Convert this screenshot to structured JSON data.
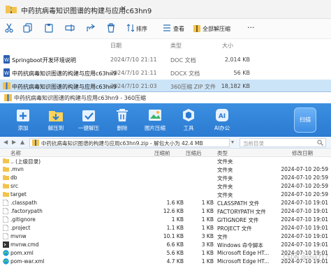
{
  "explorer": {
    "title": "中药抗病毒知识图谱的构建与应用c63hn9",
    "close_glyph": "×",
    "toolbar": {
      "sort_label": "排序",
      "view_label": "查看",
      "more_label": "···",
      "extract_all_label": "全部解压缩"
    },
    "columns": {
      "date": "日期",
      "type": "类型",
      "size": "大小"
    },
    "files": [
      {
        "name": "Springboot开发环境说明",
        "date": "2024/7/10 21:11",
        "type": "DOC 文档",
        "size": "2,014 KB",
        "icon": "word-doc-icon"
      },
      {
        "name": "中药抗病毒知识图谱的构建与应用c63hn9",
        "date": "2024/7/10 21:11",
        "type": "DOCX 文档",
        "size": "56 KB",
        "icon": "word-doc-icon"
      },
      {
        "name": "中药抗病毒知识图谱的构建与应用c63hn9",
        "date": "2024/7/10 21:03",
        "type": "360压缩 ZIP 文件",
        "size": "18,182 KB",
        "icon": "zip-archive-icon"
      }
    ]
  },
  "archive": {
    "title": "中药抗病毒知识图谱的构建与应用c63hn9 - 360压缩",
    "tools": [
      {
        "label": "添加",
        "icon": "add-icon"
      },
      {
        "label": "解压到",
        "icon": "extract-to-icon"
      },
      {
        "label": "一键解压",
        "icon": "one-click-extract-icon"
      },
      {
        "label": "删除",
        "icon": "delete-icon"
      },
      {
        "label": "图片压缩",
        "icon": "image-compress-icon"
      },
      {
        "label": "工具",
        "icon": "tools-icon"
      },
      {
        "label": "AI办公",
        "icon": "ai-office-icon"
      }
    ],
    "scan_label": "扫描",
    "path": "中药抗病毒知识图谱的构建与应用c63hn9.zip - 解包大小为 42.4 MB",
    "search_placeholder": "当前目录",
    "columns": {
      "name": "名称",
      "compressed": "压缩前",
      "size": "压缩后",
      "type": "类型",
      "date": "修改日期"
    },
    "files": [
      {
        "name": ".. (上级目录)",
        "compressed": "",
        "size": "",
        "type": "文件夹",
        "date": "",
        "icon": "folder-icon"
      },
      {
        "name": ".mvn",
        "compressed": "",
        "size": "",
        "type": "文件夹",
        "date": "2024-07-10 20:59",
        "icon": "folder-icon"
      },
      {
        "name": "db",
        "compressed": "",
        "size": "",
        "type": "文件夹",
        "date": "2024-07-10 20:59",
        "icon": "folder-icon"
      },
      {
        "name": "src",
        "compressed": "",
        "size": "",
        "type": "文件夹",
        "date": "2024-07-10 20:59",
        "icon": "folder-icon"
      },
      {
        "name": "target",
        "compressed": "",
        "size": "",
        "type": "文件夹",
        "date": "2024-07-10 20:59",
        "icon": "folder-icon"
      },
      {
        "name": ".classpath",
        "compressed": "1.6 KB",
        "size": "1 KB",
        "type": "CLASSPATH 文件",
        "date": "2024-07-10 19:01",
        "icon": "file-icon"
      },
      {
        "name": ".factorypath",
        "compressed": "12.6 KB",
        "size": "1 KB",
        "type": "FACTORYPATH 文件",
        "date": "2024-07-10 19:01",
        "icon": "file-icon"
      },
      {
        "name": ".gitignore",
        "compressed": "1 KB",
        "size": "1 KB",
        "type": "GITIGNORE 文件",
        "date": "2024-07-10 19:01",
        "icon": "file-icon"
      },
      {
        "name": ".project",
        "compressed": "1.1 KB",
        "size": "1 KB",
        "type": "PROJECT 文件",
        "date": "2024-07-10 19:01",
        "icon": "file-icon"
      },
      {
        "name": "mvnw",
        "compressed": "10.1 KB",
        "size": "3 KB",
        "type": "文件",
        "date": "2024-07-10 19:01",
        "icon": "file-icon"
      },
      {
        "name": "mvnw.cmd",
        "compressed": "6.6 KB",
        "size": "3 KB",
        "type": "Windows 命令脚本",
        "date": "2024-07-10 19:01",
        "icon": "cmd-file-icon"
      },
      {
        "name": "pom.xml",
        "compressed": "5.6 KB",
        "size": "1 KB",
        "type": "Microsoft Edge HT...",
        "date": "2024-07-10 19:01",
        "icon": "edge-xml-icon"
      },
      {
        "name": "pom-war.xml",
        "compressed": "4.7 KB",
        "size": "1 KB",
        "type": "Microsoft Edge HT...",
        "date": "2024-07-10 19:01",
        "icon": "edge-xml-icon"
      }
    ]
  },
  "watermark": "CSDN @shiji717"
}
